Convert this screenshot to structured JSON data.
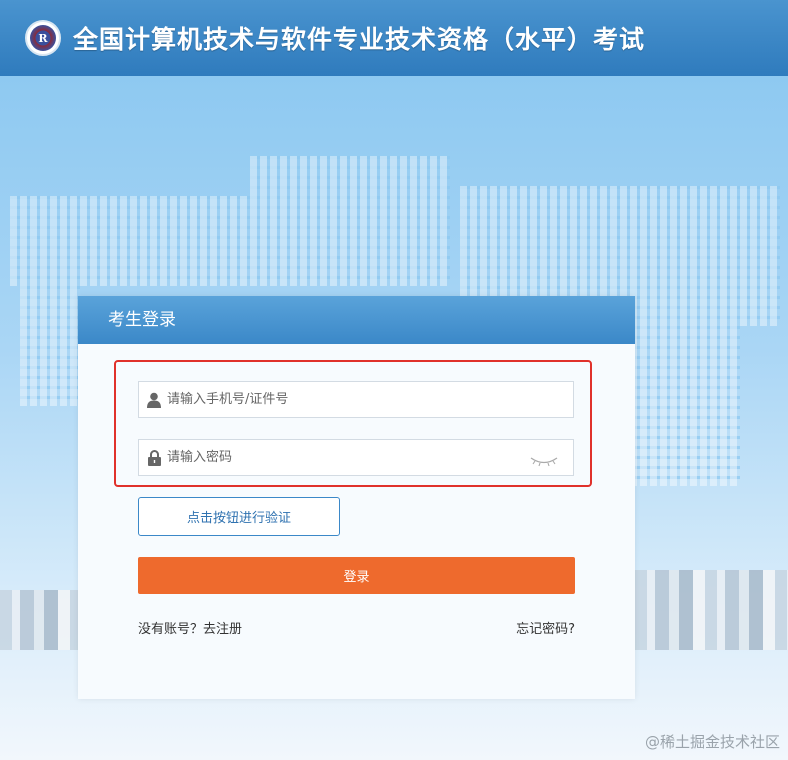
{
  "header": {
    "title": "全国计算机技术与软件专业技术资格（水平）考试",
    "logo_text": "R"
  },
  "login": {
    "title": "考生登录",
    "username_placeholder": "请输入手机号/证件号",
    "password_placeholder": "请输入密码",
    "verify_label": "点击按钮进行验证",
    "submit_label": "登录",
    "register_link": "没有账号？去注册",
    "forgot_link": "忘记密码?"
  },
  "watermark": "@稀土掘金技术社区",
  "colors": {
    "header": "#3a87c6",
    "accent": "#3b88c8",
    "login_button": "#ee6a2d",
    "highlight_border": "#e0312b"
  },
  "icons": {
    "username": "user-icon",
    "password": "lock-icon",
    "toggle": "eye-closed-icon"
  }
}
